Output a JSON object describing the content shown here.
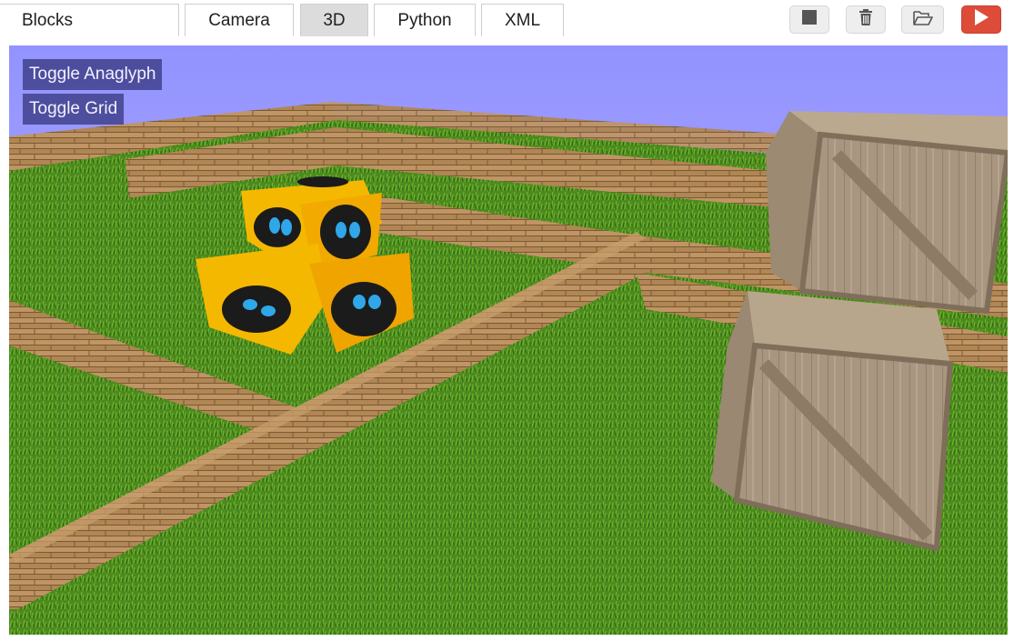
{
  "tabs": [
    {
      "label": "Blocks",
      "active": false
    },
    {
      "label": "Camera",
      "active": false
    },
    {
      "label": "3D",
      "active": true
    },
    {
      "label": "Python",
      "active": false
    },
    {
      "label": "XML",
      "active": false
    }
  ],
  "toolbar": {
    "stop_icon": "stop-icon",
    "trash_icon": "trash-icon",
    "open_icon": "folder-open-icon",
    "run_icon": "play-icon",
    "run_color": "#dd4b39"
  },
  "viewport": {
    "sky_color": "#9393ff",
    "toggle_anaglyph_label": "Toggle Anaglyph",
    "toggle_grid_label": "Toggle Grid"
  }
}
